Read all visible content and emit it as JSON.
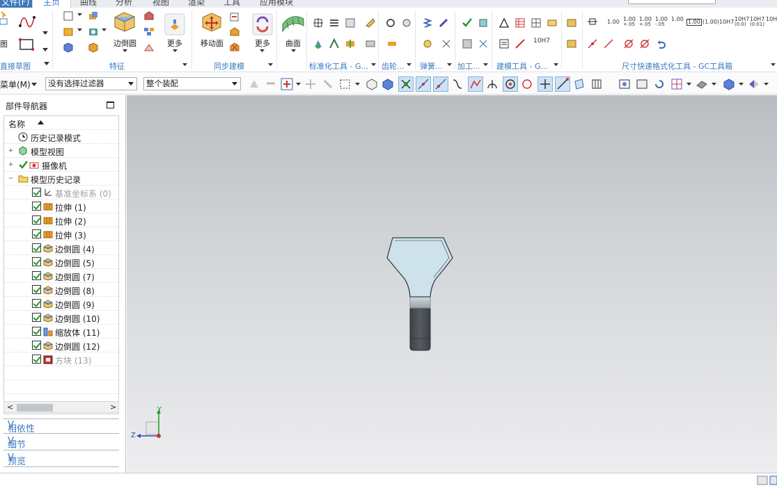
{
  "tabs": {
    "file": "文件(F)",
    "home": "主页",
    "curve": "曲线",
    "analysis": "分析",
    "view": "视图",
    "render": "渲染",
    "tools": "工具",
    "app_module": "应用模块"
  },
  "ribbon": {
    "groups": {
      "direct_sketch": "直接草图",
      "feature": "特征",
      "sync_modeling": "同步建模",
      "std_tools": "标准化工具 - G...",
      "gear": "齿轮...",
      "spring": "弹簧...",
      "machining": "加工...",
      "modeling_tools": "建模工具 - G...",
      "dim_format": "尺寸快速格式化工具 - GC工具箱"
    },
    "labels": {
      "sketch_partial": "图",
      "edge_blend": "边倒圆",
      "more1": "更多",
      "move_face": "移动面",
      "more2": "更多",
      "surface": "曲面"
    },
    "dim_values": {
      "v1": "1.00",
      "v2a": "1.00",
      "v2b": "+.05",
      "v3a": "1.00",
      "v3b": "+.05",
      "v4a": "1.00",
      "v4b": "-.05",
      "v5": "1.00",
      "v6": "(1.00)",
      "v7": "10H7",
      "v8a": "10H7",
      "v8b": "(0.0)",
      "v9a": "10H7",
      "v9b": "(0.01)",
      "v10": "10H7"
    },
    "tolerance_label": "10H7"
  },
  "toolbar2": {
    "menu": "菜单(M)",
    "filter": "没有选择过滤器",
    "assembly": "整个装配"
  },
  "navigator": {
    "title": "部件导航器",
    "column": "名称",
    "items": [
      {
        "label": "历史记录模式",
        "level": 0
      },
      {
        "label": "模型视图",
        "level": 0
      },
      {
        "label": "摄像机",
        "level": 0
      },
      {
        "label": "模型历史记录",
        "level": 0
      },
      {
        "label": "基准坐标系 (0)",
        "level": 1,
        "checked": true,
        "grey": true
      },
      {
        "label": "拉伸 (1)",
        "level": 1,
        "checked": true
      },
      {
        "label": "拉伸 (2)",
        "level": 1,
        "checked": true
      },
      {
        "label": "拉伸 (3)",
        "level": 1,
        "checked": true
      },
      {
        "label": "边倒圆 (4)",
        "level": 1,
        "checked": true
      },
      {
        "label": "边倒圆 (5)",
        "level": 1,
        "checked": true
      },
      {
        "label": "边倒圆 (7)",
        "level": 1,
        "checked": true
      },
      {
        "label": "边倒圆 (8)",
        "level": 1,
        "checked": true
      },
      {
        "label": "边倒圆 (9)",
        "level": 1,
        "checked": true
      },
      {
        "label": "边倒圆 (10)",
        "level": 1,
        "checked": true
      },
      {
        "label": "缩放体 (11)",
        "level": 1,
        "checked": true
      },
      {
        "label": "边倒圆 (12)",
        "level": 1,
        "checked": true
      },
      {
        "label": "方块 (13)",
        "level": 1,
        "checked": true,
        "grey": true
      }
    ],
    "panels": {
      "dependency": "相依性",
      "details": "细节",
      "preview": "预览"
    }
  },
  "viewport": {
    "triad_y": "Y",
    "triad_z": "Z"
  },
  "colors": {
    "accent": "#3a78c0",
    "check_green": "#1a9b2a",
    "model_face": "#cfe3ea",
    "model_dark": "#454b50"
  }
}
